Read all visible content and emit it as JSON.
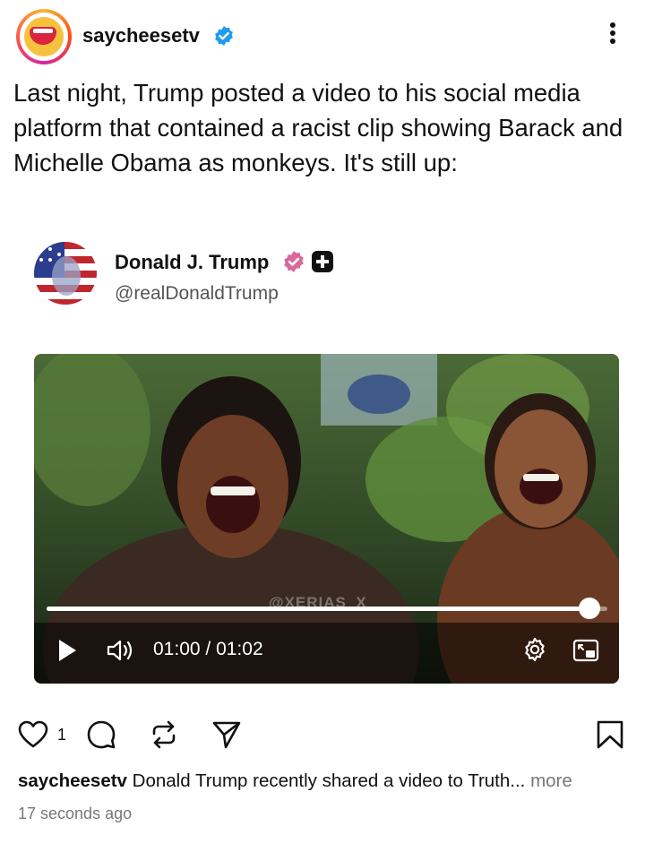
{
  "post": {
    "username": "saycheesetv",
    "caption": "Last night, Trump posted a video to his social media platform that contained a racist clip showing Barack and Michelle Obama as monkeys. It's still up:"
  },
  "embed": {
    "display_name": "Donald J. Trump",
    "handle": "@realDonaldTrump",
    "video": {
      "watermark": "@XERIAS_X",
      "current_time": "01:00",
      "time_separator": " / ",
      "duration": "01:02",
      "progress": 0.968
    }
  },
  "actions": {
    "like_count": "1"
  },
  "footer": {
    "username": "saycheesetv",
    "caption_preview": "Donald Trump recently shared a video to Truth...",
    "more_label": "more",
    "timestamp": "17 seconds ago"
  },
  "icons": {
    "verified": "verified-badge-icon",
    "more": "more-vertical-icon",
    "like": "heart-icon",
    "comment": "comment-icon",
    "repost": "repost-icon",
    "share": "send-icon",
    "save": "bookmark-icon",
    "play": "play-icon",
    "volume": "volume-icon",
    "settings": "gear-icon",
    "pip": "picture-in-picture-icon"
  },
  "colors": {
    "verified_blue": "#1d9bf0",
    "truth_badge": "#d9689b"
  }
}
